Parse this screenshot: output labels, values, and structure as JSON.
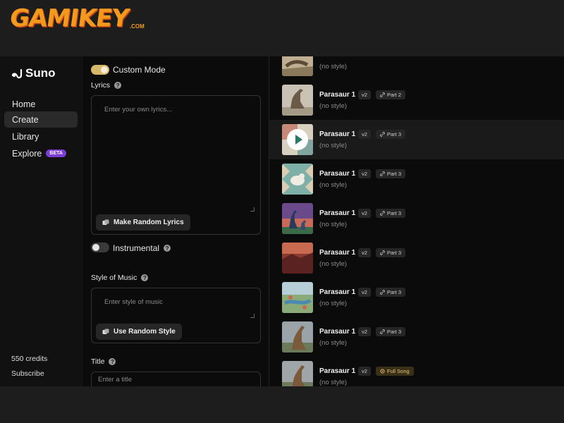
{
  "watermark": {
    "logo": "GAMIKEY",
    "domain": ".COM"
  },
  "app": {
    "name": "Suno"
  },
  "sidebar": {
    "items": [
      {
        "label": "Home"
      },
      {
        "label": "Create"
      },
      {
        "label": "Library"
      },
      {
        "label": "Explore",
        "badge": "BETA"
      }
    ],
    "credits": "550 credits",
    "subscribe": "Subscribe"
  },
  "form": {
    "custom_mode_label": "Custom Mode",
    "lyrics_label": "Lyrics",
    "lyrics_placeholder": "Enter your own lyrics...",
    "random_lyrics_button": "Make Random Lyrics",
    "instrumental_label": "Instrumental",
    "style_label": "Style of Music",
    "style_placeholder": "Enter style of music",
    "random_style_button": "Use Random Style",
    "title_label": "Title",
    "title_placeholder": "Enter a title"
  },
  "songs": [
    {
      "title": "",
      "version": "",
      "tag": "",
      "style": "(no style)"
    },
    {
      "title": "Parasaur 1",
      "version": "v2",
      "tag": "Part 2",
      "style": "(no style)"
    },
    {
      "title": "Parasaur 1",
      "version": "v2",
      "tag": "Part 3",
      "style": "(no style)"
    },
    {
      "title": "Parasaur 1",
      "version": "v2",
      "tag": "Part 3",
      "style": "(no style)"
    },
    {
      "title": "Parasaur 1",
      "version": "v2",
      "tag": "Part 3",
      "style": "(no style)"
    },
    {
      "title": "Parasaur 1",
      "version": "v2",
      "tag": "Part 3",
      "style": "(no style)"
    },
    {
      "title": "Parasaur 1",
      "version": "v2",
      "tag": "Part 3",
      "style": "(no style)"
    },
    {
      "title": "Parasaur 1",
      "version": "v2",
      "tag": "Part 3",
      "style": "(no style)"
    },
    {
      "title": "Parasaur 1",
      "version": "v2",
      "tag": "Full Song",
      "style": "(no style)"
    }
  ],
  "colors": {
    "accent_toggle": "#d6b86a",
    "beta_badge": "#7c3cd6",
    "full_song_tag": "#e8c676"
  }
}
